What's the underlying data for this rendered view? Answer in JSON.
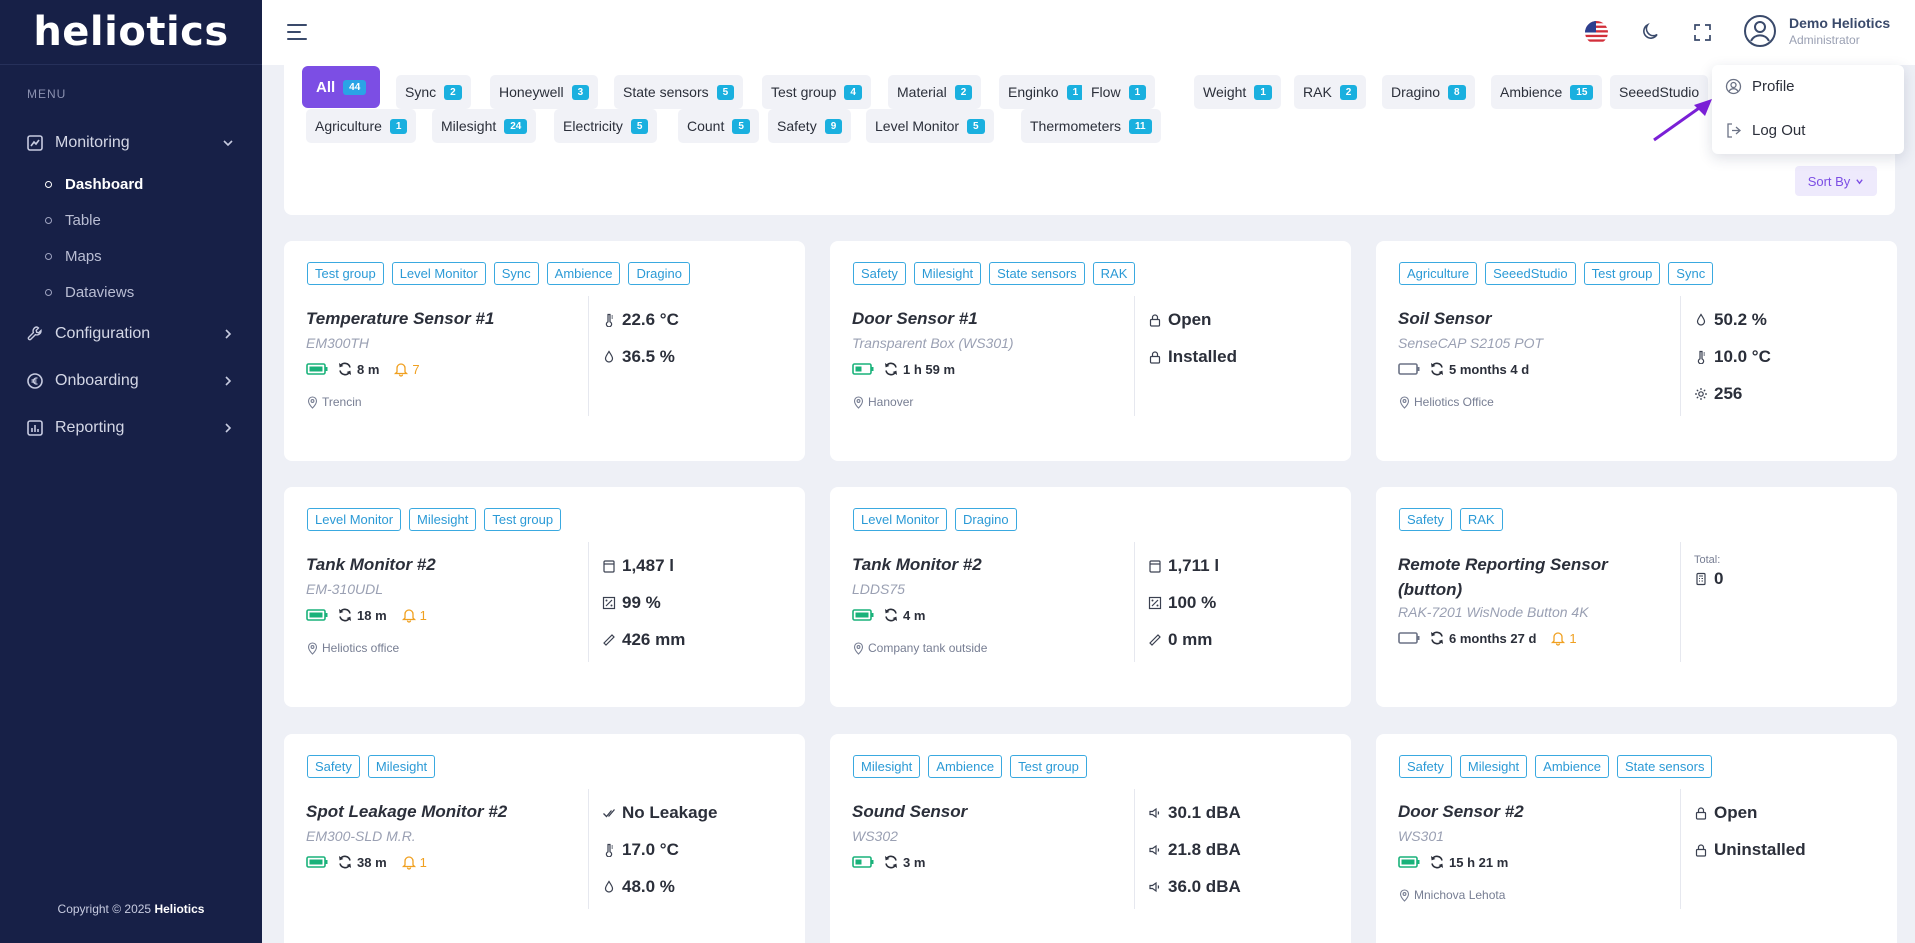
{
  "brand": "heliotics",
  "sidebar": {
    "menu_label": "MENU",
    "groups": [
      {
        "label": "Monitoring",
        "items": [
          "Dashboard",
          "Table",
          "Maps",
          "Dataviews"
        ]
      },
      {
        "label": "Configuration"
      },
      {
        "label": "Onboarding"
      },
      {
        "label": "Reporting"
      }
    ],
    "copyright_prefix": "Copyright © 2025",
    "copyright_brand": "Heliotics"
  },
  "header": {
    "user_name": "Demo Heliotics",
    "user_role": "Administrator"
  },
  "dropdown": {
    "profile": "Profile",
    "logout": "Log Out"
  },
  "filters": {
    "chips": [
      {
        "label": "All",
        "count": "44"
      },
      {
        "label": "Sync",
        "count": "2"
      },
      {
        "label": "Honeywell",
        "count": "3"
      },
      {
        "label": "State sensors",
        "count": "5"
      },
      {
        "label": "Test group",
        "count": "4"
      },
      {
        "label": "Material",
        "count": "2"
      },
      {
        "label": "Enginko",
        "count": "1"
      },
      {
        "label": "Flow",
        "count": "1"
      },
      {
        "label": "Weight",
        "count": "1"
      },
      {
        "label": "RAK",
        "count": "2"
      },
      {
        "label": "Dragino",
        "count": "8"
      },
      {
        "label": "Ambience",
        "count": "15"
      },
      {
        "label": "SeeedStudio",
        "count": ""
      },
      {
        "label": "Agriculture",
        "count": "1"
      },
      {
        "label": "Milesight",
        "count": "24"
      },
      {
        "label": "Electricity",
        "count": "5"
      },
      {
        "label": "Count",
        "count": "5"
      },
      {
        "label": "Safety",
        "count": "9"
      },
      {
        "label": "Level Monitor",
        "count": "5"
      },
      {
        "label": "Thermometers",
        "count": "11"
      }
    ],
    "sort_label": "Sort By"
  },
  "cards": [
    {
      "tags": [
        "Test group",
        "Level Monitor",
        "Sync",
        "Ambience",
        "Dragino"
      ],
      "name": "Temperature Sensor #1",
      "model": "EM300TH",
      "battery": "full",
      "sync": "8 m",
      "alarms": "7",
      "location": "Trencin",
      "readings": [
        {
          "icon": "thermometer",
          "value": "22.6 °C"
        },
        {
          "icon": "droplet",
          "value": "36.5 %"
        }
      ]
    },
    {
      "tags": [
        "Safety",
        "Milesight",
        "State sensors",
        "RAK"
      ],
      "name": "Door Sensor #1",
      "model": "Transparent Box (WS301)",
      "battery": "half",
      "sync": "1 h 59 m",
      "location": "Hanover",
      "readings": [
        {
          "icon": "lock",
          "value": "Open"
        },
        {
          "icon": "lock",
          "value": "Installed"
        }
      ]
    },
    {
      "tags": [
        "Agriculture",
        "SeeedStudio",
        "Test group",
        "Sync"
      ],
      "name": "Soil Sensor",
      "model": "SenseCAP S2105 POT",
      "battery": "empty",
      "sync": "5 months 4 d",
      "location": "Heliotics Office",
      "readings": [
        {
          "icon": "droplet",
          "value": "50.2 %"
        },
        {
          "icon": "thermometer",
          "value": "10.0 °C"
        },
        {
          "icon": "gear",
          "value": "256"
        }
      ]
    },
    {
      "tags": [
        "Level Monitor",
        "Milesight",
        "Test group"
      ],
      "name": "Tank Monitor #2",
      "model": "EM-310UDL",
      "battery": "full",
      "sync": "18 m",
      "alarms": "1",
      "location": "Heliotics office",
      "readings": [
        {
          "icon": "tank",
          "value": "1,487 l"
        },
        {
          "icon": "percent",
          "value": "99 %"
        },
        {
          "icon": "ruler",
          "value": "426 mm"
        }
      ]
    },
    {
      "tags": [
        "Level Monitor",
        "Dragino"
      ],
      "name": "Tank Monitor #2",
      "model": "LDDS75",
      "battery": "full",
      "sync": "4 m",
      "location": "Company tank outside",
      "readings": [
        {
          "icon": "tank",
          "value": "1,711 l"
        },
        {
          "icon": "percent",
          "value": "100 %"
        },
        {
          "icon": "ruler",
          "value": "0 mm"
        }
      ]
    },
    {
      "tags": [
        "Safety",
        "RAK"
      ],
      "name": "Remote Reporting Sensor (button)",
      "model": "RAK-7201 WisNode Button 4K",
      "battery": "empty",
      "sync": "6 months 27 d",
      "alarms": "1",
      "total_label": "Total:",
      "readings": [
        {
          "icon": "counter",
          "value": "0"
        }
      ]
    },
    {
      "tags": [
        "Safety",
        "Milesight"
      ],
      "name": "Spot Leakage Monitor #2",
      "model": "EM300-SLD M.R.",
      "battery": "full",
      "sync": "38 m",
      "alarms": "1",
      "readings": [
        {
          "icon": "check",
          "value": "No Leakage"
        },
        {
          "icon": "thermometer",
          "value": "17.0 °C"
        },
        {
          "icon": "droplet",
          "value": "48.0 %"
        }
      ]
    },
    {
      "tags": [
        "Milesight",
        "Ambience",
        "Test group"
      ],
      "name": "Sound Sensor",
      "model": "WS302",
      "battery": "half",
      "sync": "3 m",
      "readings": [
        {
          "icon": "speaker",
          "value": "30.1 dBA"
        },
        {
          "icon": "speaker",
          "value": "21.8 dBA"
        },
        {
          "icon": "speaker",
          "value": "36.0 dBA"
        }
      ]
    },
    {
      "tags": [
        "Safety",
        "Milesight",
        "Ambience",
        "State sensors"
      ],
      "name": "Door Sensor #2",
      "model": "WS301",
      "battery": "full",
      "sync": "15 h 21 m",
      "location": "Mnichova Lehota",
      "readings": [
        {
          "icon": "lock",
          "value": "Open"
        },
        {
          "icon": "lock",
          "value": "Uninstalled"
        }
      ]
    }
  ],
  "colors": {
    "sidebar": "#172047",
    "accent": "#7c4ee4",
    "tag": "#2b9ad6",
    "count_badge": "#1ab0df",
    "battery": "#19b27a",
    "alarm": "#f0a020"
  }
}
